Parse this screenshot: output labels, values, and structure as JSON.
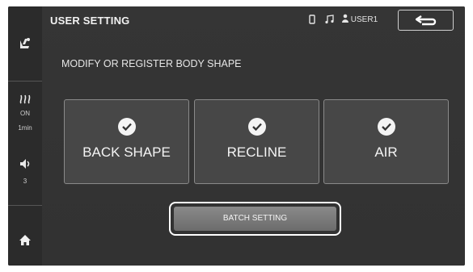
{
  "header": {
    "title": "USER SETTING",
    "user_label": "USER1",
    "phone_icon": "phone-icon",
    "music_icon": "music-note-icon",
    "user_icon": "user-icon",
    "back_icon": "return-arrow-icon"
  },
  "sidebar": {
    "mode_icon": "seat-recline-icon",
    "heat": {
      "icon": "heat-icon",
      "state": "ON",
      "timer": "1min"
    },
    "volume": {
      "icon": "speaker-icon",
      "level": "3"
    },
    "home_icon": "home-icon"
  },
  "main": {
    "subtitle": "MODIFY OR REGISTER BODY SHAPE",
    "cards": [
      {
        "label": "BACK SHAPE",
        "checked": true
      },
      {
        "label": "RECLINE",
        "checked": true
      },
      {
        "label": "AIR",
        "checked": true
      }
    ],
    "batch_button": "BATCH SETTING"
  },
  "colors": {
    "background": "#3a3a3a",
    "sidebar": "#2b2b2b",
    "card": "#474747",
    "button": "#7a7a7a"
  }
}
